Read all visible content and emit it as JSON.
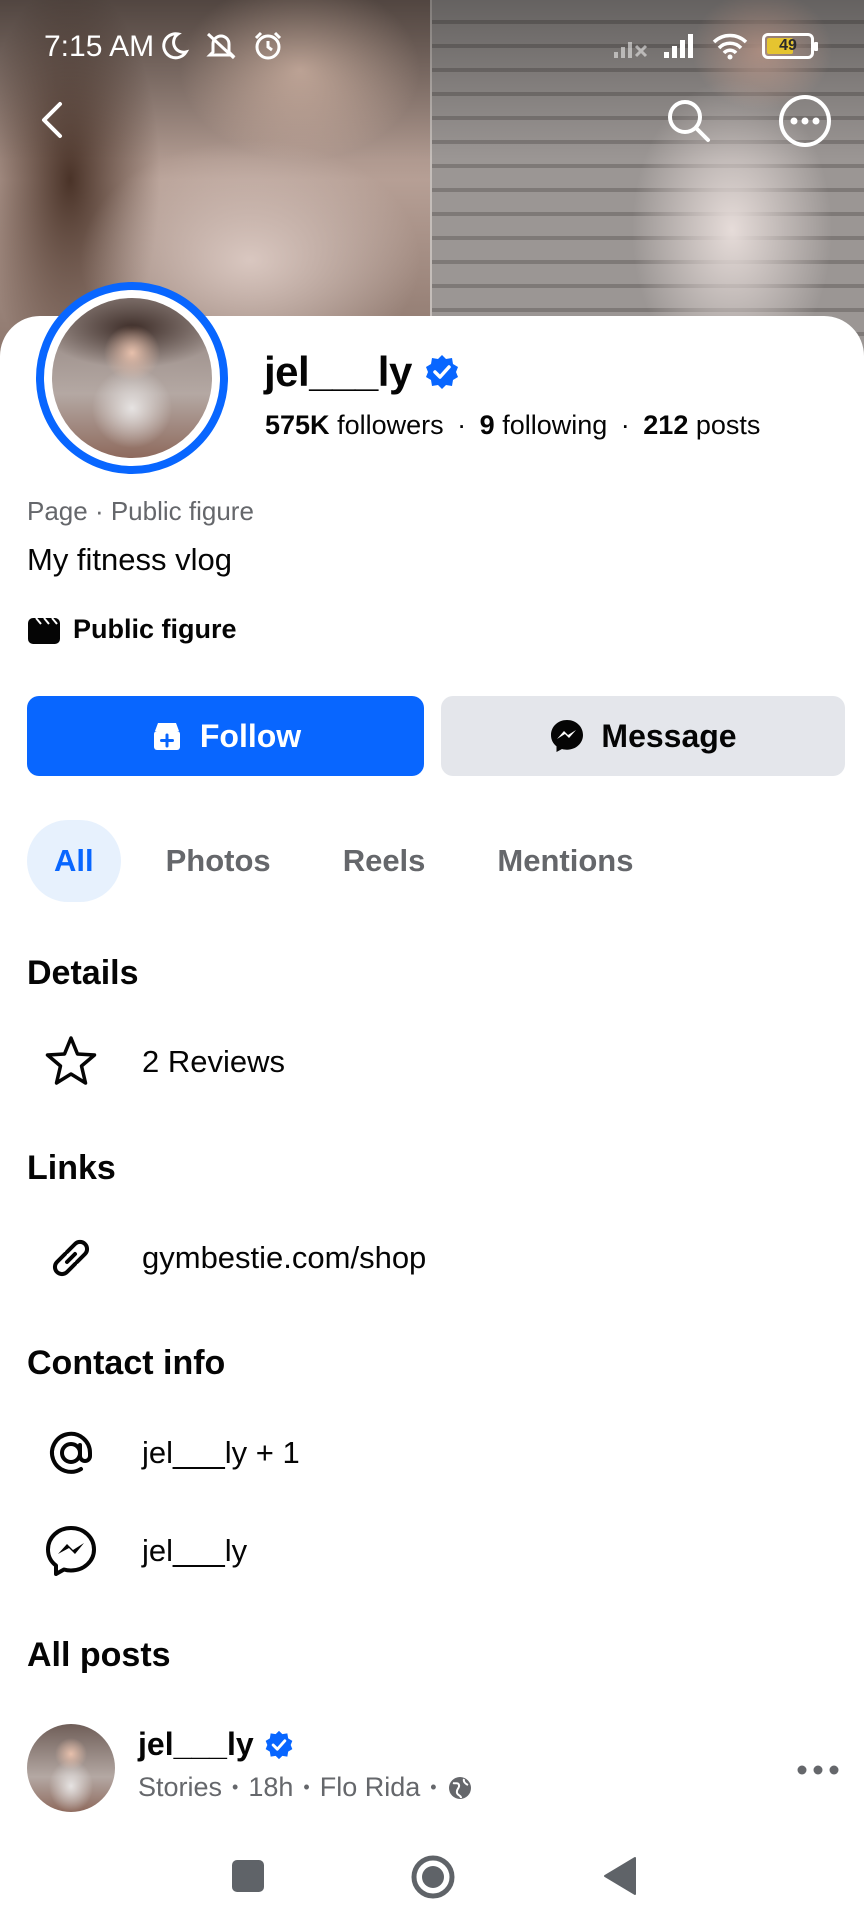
{
  "status_bar": {
    "time": "7:15 AM",
    "battery": "49",
    "icons": [
      "moon-icon",
      "bell-off-icon",
      "alarm-icon",
      "signal-off-icon",
      "signal-icon",
      "wifi-icon",
      "battery-icon"
    ]
  },
  "nav": {
    "icons": [
      "back-arrow-icon",
      "search-icon",
      "more-circle-icon"
    ]
  },
  "profile": {
    "name": "jel___ly",
    "followers_count": "575K",
    "followers_label": "followers",
    "following_count": "9",
    "following_label": "following",
    "posts_count": "212",
    "posts_label": "posts",
    "separator": "·",
    "category": "Page · Public figure",
    "bio": "My fitness vlog",
    "public_figure_label": "Public figure"
  },
  "actions": {
    "follow_label": "Follow",
    "message_label": "Message"
  },
  "tabs": [
    {
      "label": "All",
      "active": true
    },
    {
      "label": "Photos",
      "active": false
    },
    {
      "label": "Reels",
      "active": false
    },
    {
      "label": "Mentions",
      "active": false
    }
  ],
  "details": {
    "title": "Details",
    "reviews": "2 Reviews"
  },
  "links": {
    "title": "Links",
    "url": "gymbestie.com/shop"
  },
  "contact": {
    "title": "Contact info",
    "email": "jel___ly + 1",
    "messenger": "jel___ly"
  },
  "all_posts": {
    "title": "All posts",
    "author": "jel___ly",
    "meta_source": "Stories",
    "meta_time": "18h",
    "meta_music": "Flo Rida",
    "meta_dot": "•"
  },
  "colors": {
    "accent": "#0866ff",
    "secondary_text": "#65676b",
    "button_gray": "#e4e6eb",
    "active_tab_bg": "#e7f1fd"
  }
}
